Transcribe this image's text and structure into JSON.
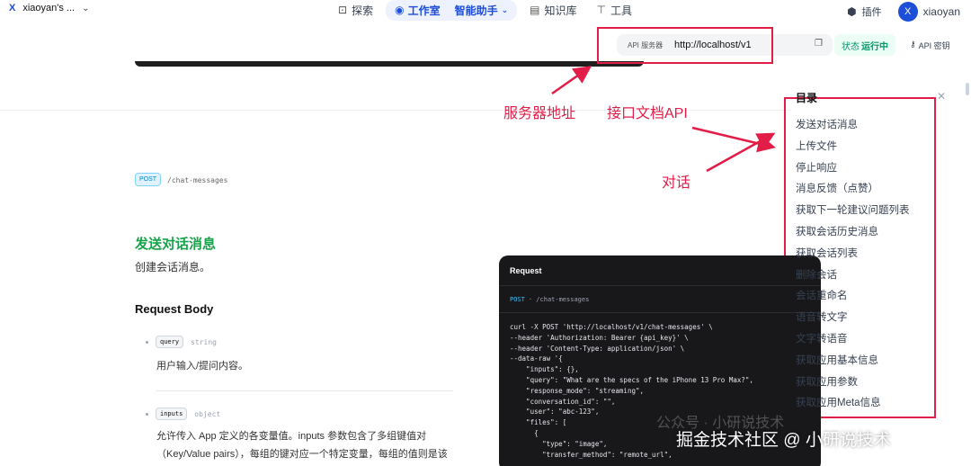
{
  "topbar": {
    "workspace": "xiaoyan's ...",
    "nav": {
      "explore": "探索",
      "studio": "工作室",
      "app": "智能助手",
      "knowledge": "知识库",
      "tools": "工具"
    },
    "plugin": "插件",
    "avatar_letter": "X",
    "username": "xiaoyan"
  },
  "api": {
    "server_label": "API 服务器",
    "server_url": "http://localhost/v1",
    "status_label": "状态",
    "status_value": "运行中",
    "key_label": "API 密钥"
  },
  "annotations": {
    "server_address": "服务器地址",
    "doc_api": "接口文档API",
    "chat": "对话"
  },
  "endpoint": {
    "method": "POST",
    "path": "/chat-messages",
    "title": "发送对话消息",
    "description": "创建会话消息。"
  },
  "request_body": {
    "title": "Request Body",
    "params": [
      {
        "name": "query",
        "type": "string",
        "desc": "用户输入/提问内容。"
      },
      {
        "name": "inputs",
        "type": "object",
        "desc": "允许传入 App 定义的各变量值。inputs 参数包含了多组键值对（Key/Value pairs），每组的键对应一个特定变量，每组的值则是该变量的具"
      }
    ]
  },
  "code": {
    "header": "Request",
    "method": "POST",
    "path": "/chat-messages",
    "lines": [
      "curl -X POST 'http://localhost/v1/chat-messages' \\",
      "--header 'Authorization: Bearer {api_key}' \\",
      "--header 'Content-Type: application/json' \\",
      "--data-raw '{",
      "    \"inputs\": {},",
      "    \"query\": \"What are the specs of the iPhone 13 Pro Max?\",",
      "    \"response_mode\": \"streaming\",",
      "    \"conversation_id\": \"\",",
      "    \"user\": \"abc-123\",",
      "    \"files\": [",
      "      {",
      "        \"type\": \"image\",",
      "        \"transfer_method\": \"remote_url\","
    ]
  },
  "toc": {
    "title": "目录",
    "items": [
      "发送对话消息",
      "上传文件",
      "停止响应",
      "消息反馈（点赞）",
      "获取下一轮建议问题列表",
      "获取会话历史消息",
      "获取会话列表",
      "删除会话",
      "会话重命名",
      "语音转文字",
      "文字转语音",
      "获取应用基本信息",
      "获取应用参数",
      "获取应用Meta信息"
    ]
  },
  "watermark": {
    "line1": "公众号 · 小研说技术",
    "line2": "掘金技术社区 @ 小研说技术"
  },
  "colors": {
    "accent": "#1d4ed8",
    "annotation": "#e11d48",
    "success": "#16a34a"
  }
}
